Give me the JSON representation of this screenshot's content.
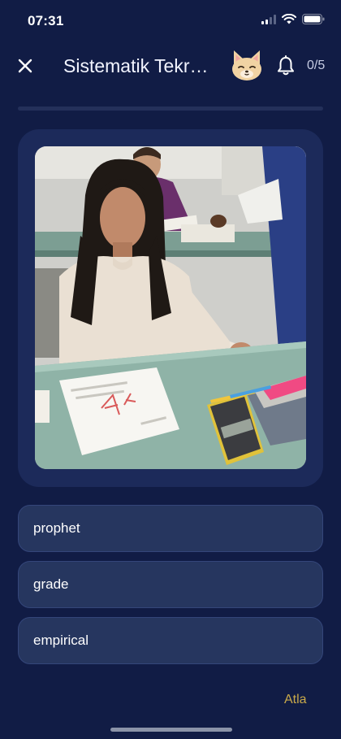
{
  "status_bar": {
    "time": "07:31"
  },
  "header": {
    "title": "Sistematik Tekr…",
    "counter": "0/5"
  },
  "progress": {
    "fraction": 0.0
  },
  "question": {
    "image_alt": "Woman at a classroom desk looking at a graded paper marked F, with a calculator and books"
  },
  "options": [
    {
      "label": "prophet"
    },
    {
      "label": "grade"
    },
    {
      "label": "empirical"
    }
  ],
  "footer": {
    "skip_label": "Atla"
  },
  "colors": {
    "background": "#111c45",
    "card": "#1c2a5a",
    "option": "#26365f",
    "skip": "#c9a94a"
  },
  "icons": [
    "close-icon",
    "mascot-fox-icon",
    "bell-icon",
    "wifi-icon",
    "battery-icon",
    "signal-icon"
  ]
}
